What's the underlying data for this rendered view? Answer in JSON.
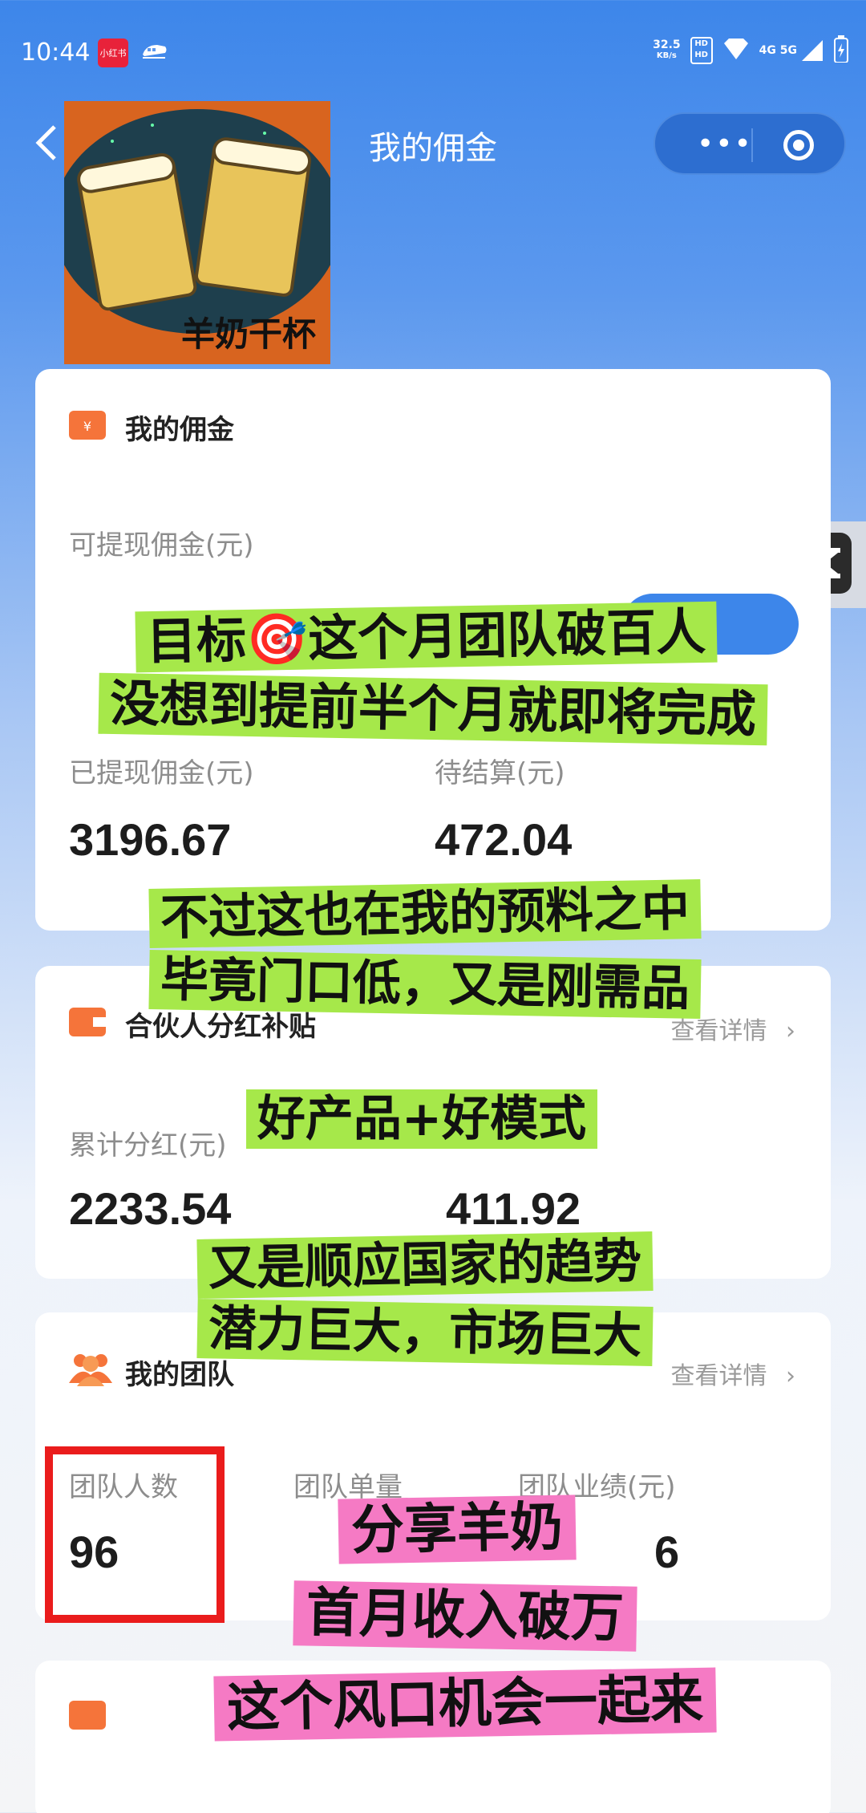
{
  "status_bar": {
    "time": "10:44",
    "app_badge": "小红书",
    "net_speed": "32.5",
    "net_unit": "KB/s",
    "network": "4G 5G"
  },
  "nav": {
    "title": "我的佣金",
    "more_icon": "more-dots-icon",
    "close_icon": "target-icon"
  },
  "sticker": {
    "caption": "羊奶干杯"
  },
  "commission": {
    "title": "我的佣金",
    "withdrawable_label": "可提现佣金(元)",
    "withdrawn_label": "已提现佣金(元)",
    "withdrawn_value": "3196.67",
    "pending_label": "待结算(元)",
    "pending_value": "472.04"
  },
  "dividend": {
    "title": "合伙人分红补贴",
    "detail": "查看详情",
    "total_label": "累计分红(元)",
    "total_value": "2233.54",
    "second_value": "411.92"
  },
  "team": {
    "title": "我的团队",
    "detail": "查看详情",
    "count_label": "团队人数",
    "count_value": "96",
    "orders_label": "团队单量",
    "perf_label": "团队业绩(元)",
    "perf_value_tail": "6"
  },
  "overlays": {
    "green1_line1": "目标🎯这个月团队破百人",
    "green1_line2": "没想到提前半个月就即将完成",
    "green2_line1": "不过这也在我的预料之中",
    "green2_line2": "毕竟门口低，又是刚需品",
    "green3": "好产品+好模式",
    "green4_line1": "又是顺应国家的趋势",
    "green4_line2": "潜力巨大，市场巨大",
    "pink_line1": "分享羊奶",
    "pink_line2": "首月收入破万",
    "pink_line3": "这个风口机会一起来"
  },
  "colors": {
    "primary_blue": "#3d86ea",
    "overlay_green": "#a6e84a",
    "overlay_pink": "#f57ac4",
    "highlight_red": "#ea1c1c",
    "icon_orange": "#f5743a"
  }
}
